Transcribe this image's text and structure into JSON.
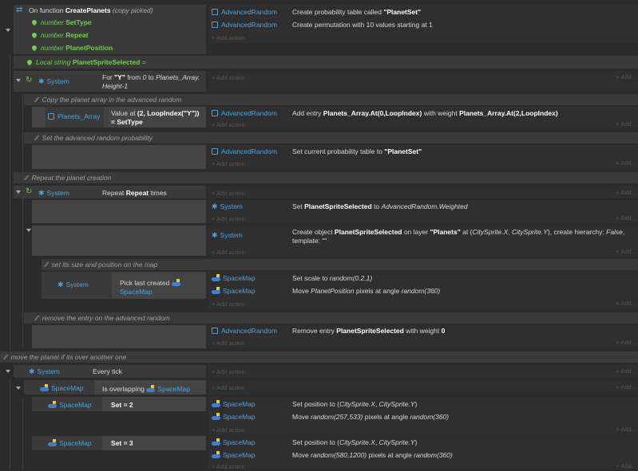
{
  "add_action": "+ Add action",
  "add_short": "+ Add...",
  "fn_header": {
    "prefix": "On function",
    "name": "CreatePlanets",
    "suffix": "(copy picked)"
  },
  "params": [
    {
      "type": "number",
      "name": "SetType"
    },
    {
      "type": "number",
      "name": "Repeat"
    },
    {
      "type": "number",
      "name": "PlanetPosition"
    }
  ],
  "fn_actions": [
    {
      "object": "AdvancedRandom",
      "pre": "Create probability table called ",
      "bold": "\"PlanetSet\"",
      "post": ""
    },
    {
      "object": "AdvancedRandom",
      "pre": "Create permutation with 10 values starting at 1",
      "bold": "",
      "post": ""
    }
  ],
  "local_var": {
    "prefix": "Local string",
    "name": "PlanetSpriteSelected",
    "suffix": "="
  },
  "for_event": {
    "object": "System",
    "cond_line1_pre": "For ",
    "cond_line1_bold": "\"Y\"",
    "cond_line1_mid": " from ",
    "cond_line1_i1": "0",
    "cond_line1_post": " to ",
    "cond_line1_i2": "Planets_Array.",
    "cond_line2": "Height-1"
  },
  "comment_copy": "Copy the planet array in the advanced random",
  "planets_cond": {
    "object": "Planets_Array",
    "line1_pre": "Value at ",
    "line1_bold": "(2, LoopIndex(\"Y\"))",
    "line2_bold": "= SetType"
  },
  "add_entry": {
    "object": "AdvancedRandom",
    "pre": "Add entry ",
    "b1": "Planets_Array.At(0,LoopIndex)",
    "mid": " with weight ",
    "b2": "Planets_Array.At(2,LoopIndex)"
  },
  "comment_prob": "Set the advanced random probability",
  "set_table": {
    "object": "AdvancedRandom",
    "pre": "Set current probability table to ",
    "bold": "\"PlanetSet\""
  },
  "comment_repeat": "Repeat the planet creation",
  "repeat_event": {
    "object": "System",
    "pre": "Repeat ",
    "bold": "Repeat",
    "post": " times"
  },
  "set_var": {
    "object": "System",
    "pre": "Set ",
    "bold": "PlanetSpriteSelected",
    "mid": " to ",
    "italic": "AdvancedRandom.Weighted"
  },
  "create_obj": {
    "object": "System",
    "l1_pre": "Create object ",
    "l1_b1": "PlanetSpriteSelected",
    "l1_mid": " on layer ",
    "l1_b2": "\"Planets\"",
    "l1_mid2": " at (",
    "l1_i1": "CitySprite.X",
    "l1_c": ", ",
    "l1_i2": "CitySprite.Y",
    "l1_post": "), create hierarchy: ",
    "l1_i3": "False",
    "l1_end": ",",
    "l2": "template: \"\""
  },
  "comment_size": "set its size and position on the map",
  "pick_cond": {
    "object": "System",
    "line1": "Pick last created",
    "line2": "SpaceMap"
  },
  "scale_actions": [
    {
      "object": "SpaceMap",
      "pre": "Set scale to ",
      "italic": "random(0.2,1)",
      "post": ""
    },
    {
      "object": "SpaceMap",
      "pre": "Move ",
      "italic": "PlanetPosition",
      "post": " pixels at angle ",
      "italic2": "random(360)"
    }
  ],
  "comment_remove": "remove the entry on the advanced random",
  "remove_entry": {
    "object": "AdvancedRandom",
    "pre": "Remove entry ",
    "bold": "PlanetSpriteSelected",
    "mid": " with weight ",
    "bold2": "0"
  },
  "comment_move": "move the planet if its over another one",
  "every_tick": {
    "object": "System",
    "text": "Every tick"
  },
  "overlap": {
    "object": "SpaceMap",
    "text": "Is overlapping",
    "object2": "SpaceMap"
  },
  "set2": {
    "object": "SpaceMap",
    "text": "Set",
    "value": "= 2",
    "a1_pre": "Set position to (",
    "a1_i1": "CitySprite.X",
    "a1_c": ", ",
    "a1_i2": "CitySprite.Y",
    "a1_post": ")",
    "a2_pre": "Move ",
    "a2_i": "random(257,533)",
    "a2_mid": " pixels at angle ",
    "a2_i2": "random(360)"
  },
  "set3": {
    "object": "SpaceMap",
    "text": "Set",
    "value": "= 3",
    "a1_pre": "Set position to (",
    "a1_i1": "CitySprite.X",
    "a1_c": ", ",
    "a1_i2": "CitySprite.Y",
    "a1_post": ")",
    "a2_pre": "Move ",
    "a2_i": "random(580,1200)",
    "a2_mid": " pixels at angle ",
    "a2_i2": "random(360)"
  }
}
